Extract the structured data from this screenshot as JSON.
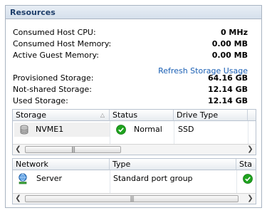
{
  "panel": {
    "title": "Resources"
  },
  "resources": [
    {
      "label": "Consumed Host CPU:",
      "value": "0 MHz"
    },
    {
      "label": "Consumed Host Memory:",
      "value": "0.00 MB"
    },
    {
      "label": "Active Guest Memory:",
      "value": "0.00 MB"
    }
  ],
  "refresh_link": "Refresh Storage Usage",
  "storage_summary": [
    {
      "label": "Provisioned Storage:",
      "value": "64.16 GB"
    },
    {
      "label": "Not-shared Storage:",
      "value": "12.14 GB"
    },
    {
      "label": "Used Storage:",
      "value": "12.14 GB"
    }
  ],
  "storage_table": {
    "columns": [
      "Storage",
      "Status",
      "Drive Type"
    ],
    "rows": [
      {
        "storage": "NVME1",
        "status": "Normal",
        "drive_type": "SSD"
      }
    ],
    "status_color": "#1fa31f"
  },
  "network_table": {
    "columns": [
      "Network",
      "Type",
      "Sta"
    ],
    "rows": [
      {
        "network": "Server",
        "type": "Standard port group"
      }
    ]
  },
  "scroll_icons": {
    "left": "chevron-left-icon",
    "right": "chevron-right-icon",
    "grip": "scroll-grip-icon"
  }
}
